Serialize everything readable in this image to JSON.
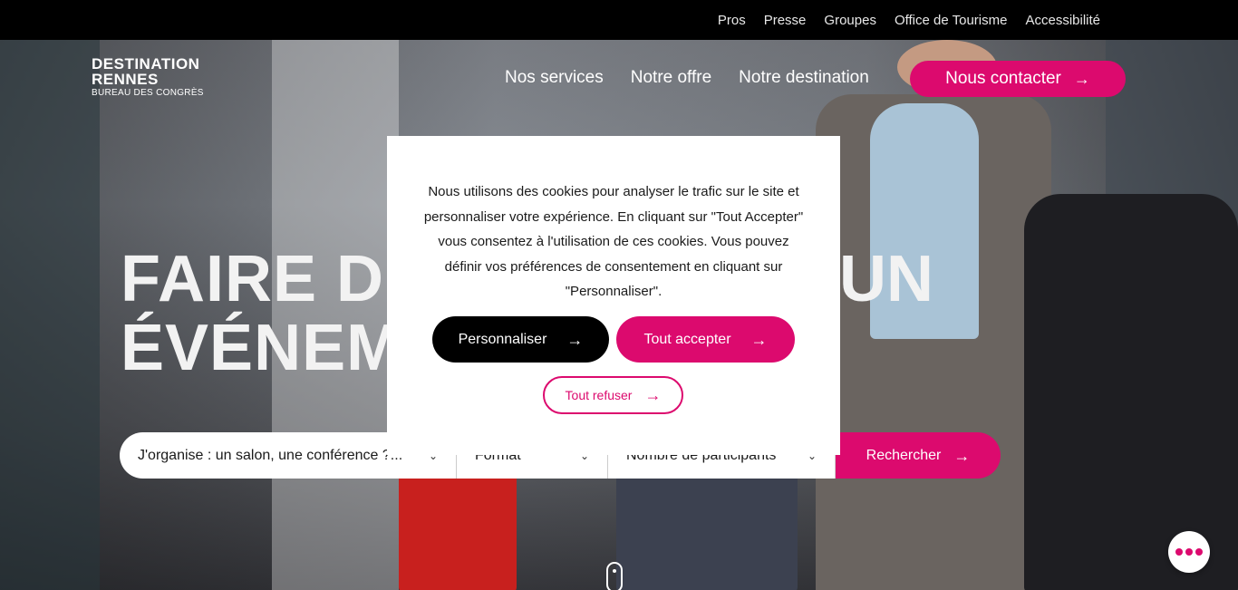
{
  "topbar": {
    "links": [
      "Pros",
      "Presse",
      "Groupes",
      "Office de Tourisme",
      "Accessibilité"
    ]
  },
  "logo": {
    "line1": "DESTINATION",
    "line2": "RENNES",
    "line3": "BUREAU DES CONGRÈS"
  },
  "mainnav": {
    "items": [
      "Nos services",
      "Notre offre",
      "Notre destination"
    ],
    "contact_label": "Nous contacter"
  },
  "hero": {
    "headline_line1": "FAIRE DE",
    "headline_line2": "ÉVÉNEME",
    "headline_right": "UN"
  },
  "search": {
    "field1": "J'organise : un salon, une conférence ?...",
    "field2": "Format",
    "field3": "Nombre de participants",
    "button_label": "Rechercher"
  },
  "cookie": {
    "text": "Nous utilisons des cookies pour analyser le trafic sur le site et personnaliser votre expérience. En cliquant sur \"Tout Accepter\" vous consentez à l'utilisation de ces cookies. Vous pouvez définir vos préférences de consentement en cliquant sur \"Personnaliser\".",
    "personalize_label": "Personnaliser",
    "accept_label": "Tout accepter",
    "refuse_label": "Tout refuser"
  },
  "colors": {
    "accent": "#dc0a6e",
    "topbar": "#000000"
  },
  "icons": {
    "arrow": "arrow-right-icon",
    "chevron": "chevron-down-icon",
    "menu": "dots-icon"
  }
}
